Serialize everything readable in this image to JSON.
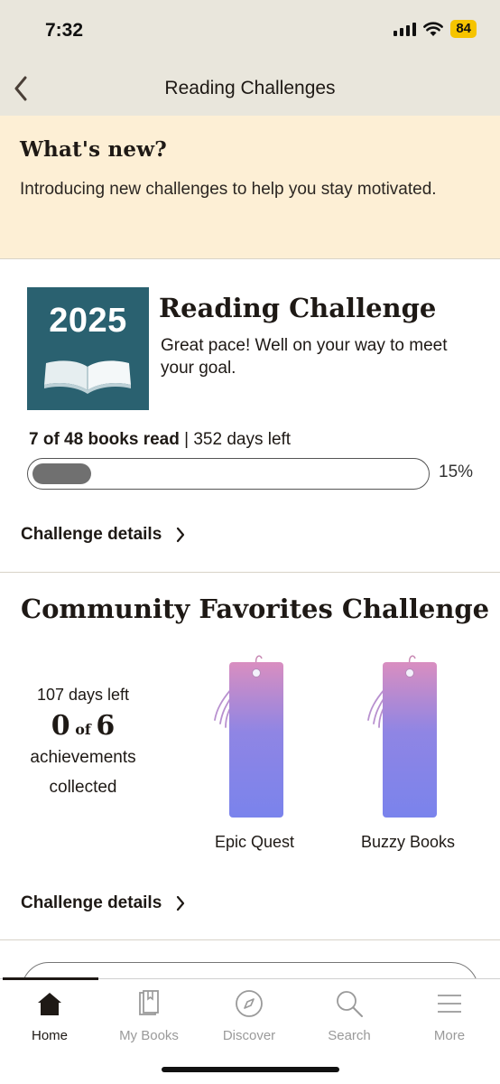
{
  "status_bar": {
    "time": "7:32",
    "battery": "84"
  },
  "nav": {
    "title": "Reading Challenges"
  },
  "whats_new": {
    "title": "What's new?",
    "body": "Introducing new challenges to help you stay motivated."
  },
  "reading_challenge": {
    "year": "2025",
    "title": "Reading Challenge",
    "subtitle": "Great pace! Well on your way to meet your goal.",
    "books_read_text": "7 of 48 books read",
    "separator": " | ",
    "days_left_text": "352 days left",
    "progress": 0.15,
    "progress_label": "15%",
    "details_label": "Challenge details"
  },
  "community_challenge": {
    "title": "Community Favorites Challenge",
    "days_left": "107 days left",
    "achieved": "0",
    "of_word": "of",
    "total": "6",
    "caption_line1": "achievements",
    "caption_line2": "collected",
    "bookmarks": [
      {
        "label": "Epic Quest"
      },
      {
        "label": "Buzzy Books"
      }
    ],
    "details_label": "Challenge details"
  },
  "tab_bar": {
    "tabs": [
      {
        "label": "Home",
        "icon": "home-icon",
        "active": true
      },
      {
        "label": "My Books",
        "icon": "books-icon",
        "active": false
      },
      {
        "label": "Discover",
        "icon": "compass-icon",
        "active": false
      },
      {
        "label": "Search",
        "icon": "search-icon",
        "active": false
      },
      {
        "label": "More",
        "icon": "menu-icon",
        "active": false
      }
    ]
  },
  "colors": {
    "nav_background": "#e9e6dc",
    "banner_background": "#fdefd5",
    "badge_teal": "#2a6170",
    "battery_yellow": "#f6c400",
    "progress_fill": "#707070",
    "bookmark_top": "#d98ec0",
    "bookmark_bottom": "#7a83ec"
  }
}
